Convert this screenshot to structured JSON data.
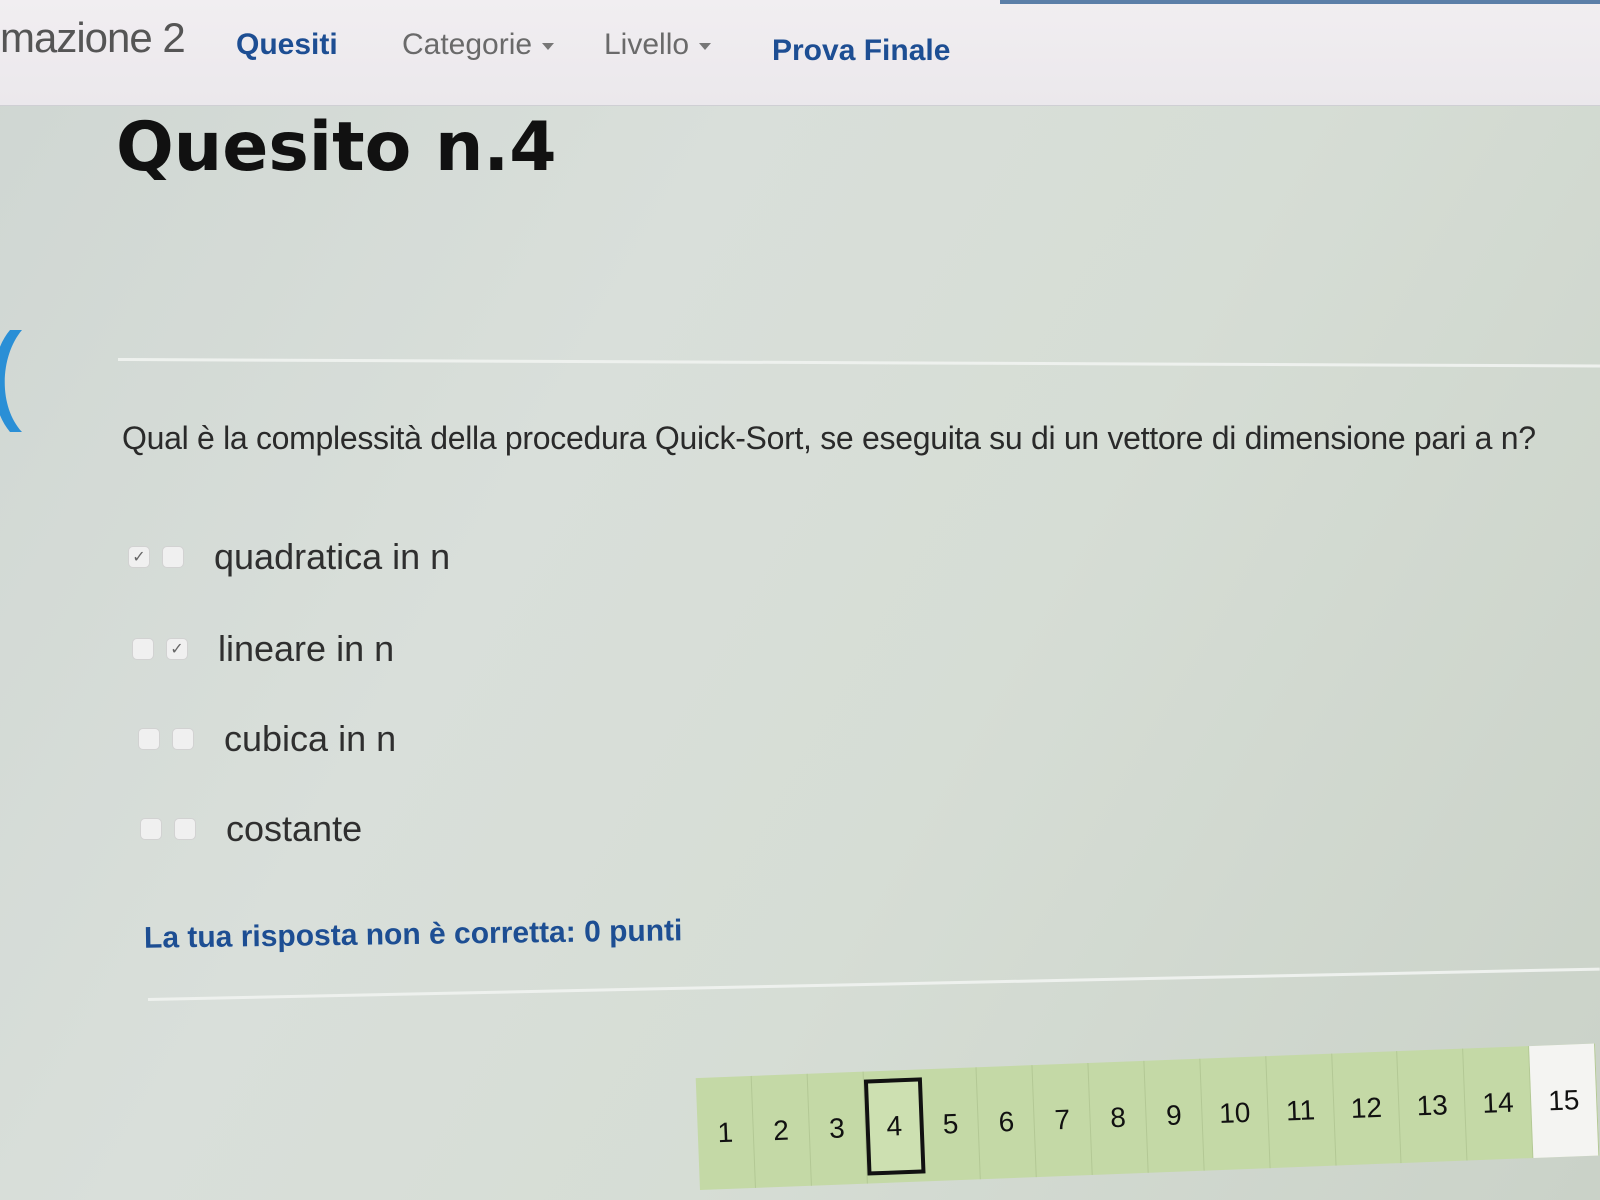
{
  "navbar": {
    "brand": "mazione 2",
    "items": [
      {
        "label": "Quesiti",
        "active": true
      },
      {
        "label": "Categorie",
        "dropdown": true
      },
      {
        "label": "Livello",
        "dropdown": true
      },
      {
        "label": "Prova Finale"
      }
    ]
  },
  "question": {
    "title": "Quesito n.4",
    "text": "Qual è la complessità della procedura Quick-Sort, se eseguita su di un vettore di dimensione pari a n?",
    "options": [
      {
        "label": "quadratica in n",
        "given_answer": true,
        "correct_answer": false
      },
      {
        "label": "lineare in n",
        "given_answer": false,
        "correct_answer": true
      },
      {
        "label": "cubica in n",
        "given_answer": false,
        "correct_answer": false
      },
      {
        "label": "costante",
        "given_answer": false,
        "correct_answer": false
      }
    ],
    "feedback": "La tua risposta non è corretta: 0 punti"
  },
  "pagination": {
    "pages": [
      "1",
      "2",
      "3",
      "4",
      "5",
      "6",
      "7",
      "8",
      "9",
      "10",
      "11",
      "12",
      "13",
      "14",
      "15"
    ],
    "current": "4"
  },
  "colors": {
    "accent": "#1d4e93",
    "pager_bg": "#c4d9a6",
    "back_arrow": "#2a8fd6"
  },
  "icons": {
    "back": "chevron-left-icon",
    "check": "checkmark-icon",
    "caret": "caret-down-icon"
  }
}
